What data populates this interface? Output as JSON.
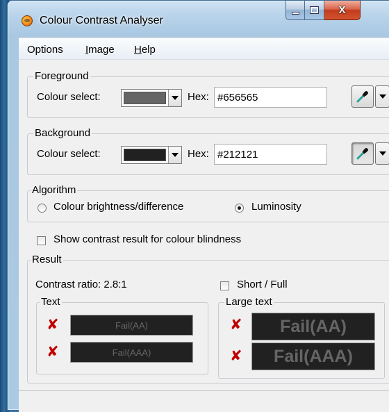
{
  "window": {
    "title": "Colour Contrast Analyser",
    "close_glyph": "X"
  },
  "menu": [
    {
      "prefix": "",
      "underline": "",
      "rest": "Options"
    },
    {
      "prefix": "",
      "underline": "I",
      "rest": "mage"
    },
    {
      "prefix": "",
      "underline": "H",
      "rest": "elp"
    }
  ],
  "foreground": {
    "legend": "Foreground",
    "colour_select_label": "Colour select:",
    "swatch_color": "#656565",
    "hex_label": "Hex:",
    "hex_value": "#656565",
    "picker_icon": "eyedropper-icon"
  },
  "background": {
    "legend": "Background",
    "colour_select_label": "Colour select:",
    "swatch_color": "#212121",
    "hex_label": "Hex:",
    "hex_value": "#212121",
    "picker_icon": "eyedropper-icon"
  },
  "algorithm": {
    "legend": "Algorithm",
    "options": [
      "Colour brightness/difference",
      "Luminosity"
    ],
    "selected": "Luminosity"
  },
  "colour_blindness_checkbox": "Show contrast result for colour blindness",
  "result": {
    "legend": "Result",
    "contrast_ratio": "Contrast ratio: 2.8:1",
    "short_full_label": "Short / Full",
    "text_group": {
      "legend": "Text",
      "rows": [
        {
          "status_icon": "cross-icon",
          "label": "Fail(AA)"
        },
        {
          "status_icon": "cross-icon",
          "label": "Fail(AAA)"
        }
      ]
    },
    "large_text_group": {
      "legend": "Large text",
      "rows": [
        {
          "status_icon": "cross-icon",
          "label": "Fail(AA)"
        },
        {
          "status_icon": "cross-icon",
          "label": "Fail(AAA)"
        }
      ]
    },
    "cross_glyph": "✘",
    "fail_color": "#c00000",
    "sample_text_color": "#656565",
    "sample_bg_color": "#212121"
  }
}
